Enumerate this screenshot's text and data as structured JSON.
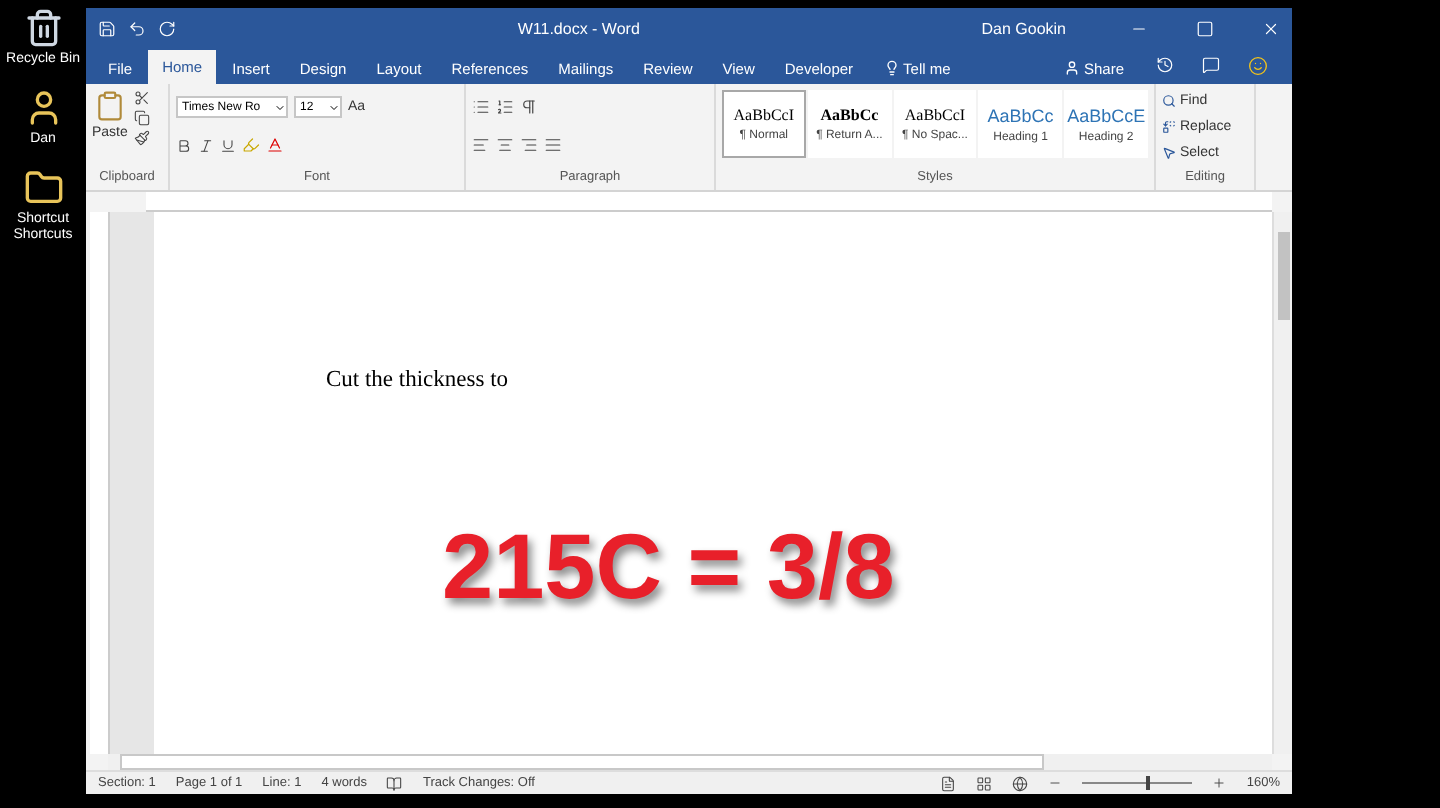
{
  "desktop_icons": [
    {
      "label": "Recycle Bin",
      "kind": "bin"
    },
    {
      "label": "Dan",
      "kind": "user"
    },
    {
      "label": "Shortcut Shortcuts",
      "kind": "folder"
    }
  ],
  "window": {
    "title": "W11.docx - Word",
    "user": "Dan Gookin"
  },
  "tabs": [
    {
      "label": "File",
      "selected": false
    },
    {
      "label": "Home",
      "selected": true
    },
    {
      "label": "Insert",
      "selected": false
    },
    {
      "label": "Design",
      "selected": false
    },
    {
      "label": "Layout",
      "selected": false
    },
    {
      "label": "References",
      "selected": false
    },
    {
      "label": "Mailings",
      "selected": false
    },
    {
      "label": "Review",
      "selected": false
    },
    {
      "label": "View",
      "selected": false
    },
    {
      "label": "Developer",
      "selected": false
    }
  ],
  "tell_me": "Tell me",
  "share": "Share",
  "clipboard": {
    "paste": "Paste",
    "label": "Clipboard"
  },
  "font": {
    "name": "Times New Ro",
    "size": "12",
    "change_case": "Aa",
    "label": "Font"
  },
  "paragraph": {
    "label": "Paragraph"
  },
  "styles": {
    "label": "Styles",
    "items": [
      {
        "preview": "AaBbCcI",
        "name": "¶ Normal",
        "selected": true,
        "kind": "plain"
      },
      {
        "preview": "AaBbCc",
        "name": "¶ Return A...",
        "selected": false,
        "kind": "bold"
      },
      {
        "preview": "AaBbCcI",
        "name": "¶ No Spac...",
        "selected": false,
        "kind": "plain"
      },
      {
        "preview": "AaBbCc",
        "name": "Heading 1",
        "selected": false,
        "kind": "heading"
      },
      {
        "preview": "AaBbCcE",
        "name": "Heading 2",
        "selected": false,
        "kind": "heading"
      }
    ]
  },
  "editing": {
    "label": "Editing",
    "items": [
      {
        "label": "Find",
        "kind": "find"
      },
      {
        "label": "Replace",
        "kind": "replace"
      },
      {
        "label": "Select",
        "kind": "select"
      }
    ]
  },
  "document": {
    "text": "Cut the thickness to"
  },
  "overlay": {
    "text": "215C = 3/8"
  },
  "status_bar": {
    "items": [
      "Section: 1",
      "Page 1 of 1",
      "Line: 1",
      "4 words"
    ],
    "track_changes": "Track Changes: Off",
    "zoom": "160%",
    "zoom_level": {
      "level": 0.57
    }
  }
}
